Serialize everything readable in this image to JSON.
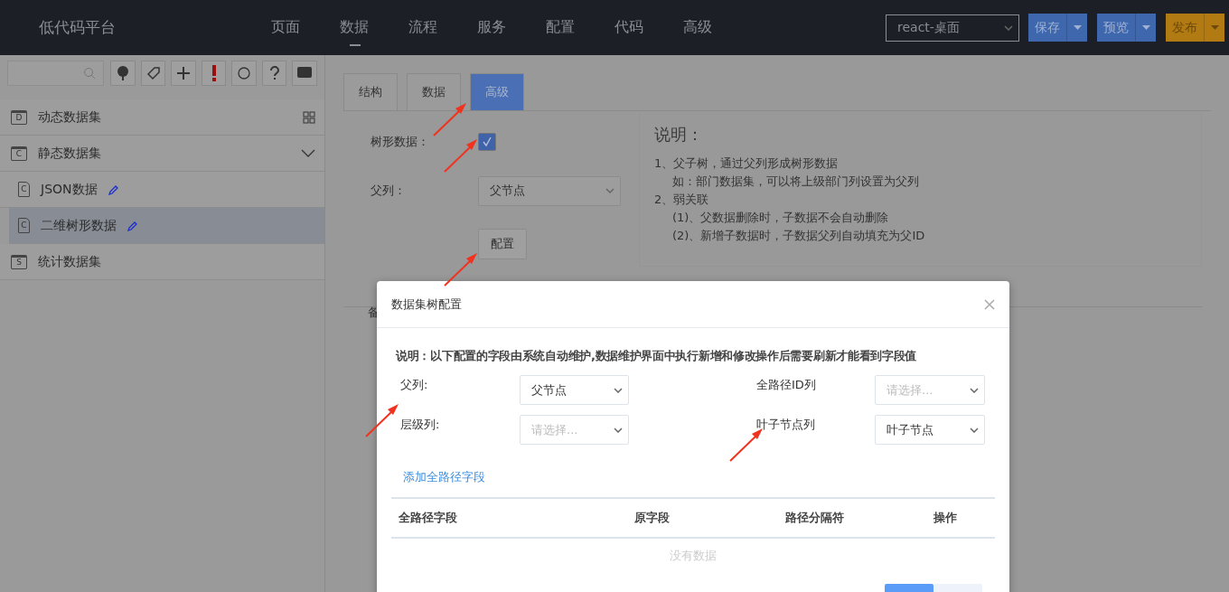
{
  "app": {
    "title": "低代码平台"
  },
  "nav": [
    {
      "label": "页面",
      "selected": false
    },
    {
      "label": "数据",
      "selected": true
    },
    {
      "label": "流程",
      "selected": false
    },
    {
      "label": "服务",
      "selected": false
    },
    {
      "label": "配置",
      "selected": false
    },
    {
      "label": "代码",
      "selected": false
    },
    {
      "label": "高级",
      "selected": false
    }
  ],
  "platform_select": {
    "value": "react-桌面"
  },
  "actions": [
    {
      "label": "保存",
      "kind": "primary"
    },
    {
      "label": "预览",
      "kind": "primary"
    },
    {
      "label": "发布",
      "kind": "warning"
    }
  ],
  "sidebar": {
    "toolbar": [
      {
        "kind": "tree"
      },
      {
        "kind": "tag"
      },
      {
        "kind": "plus"
      },
      {
        "kind": "alert"
      },
      {
        "kind": "refresh"
      },
      {
        "kind": "help"
      },
      {
        "kind": "chat"
      }
    ],
    "items": [
      {
        "label": "动态数据集",
        "letter": "D",
        "kind": "group",
        "expanded": false,
        "selected": false
      },
      {
        "label": "静态数据集",
        "letter": "C",
        "kind": "group",
        "expanded": true,
        "selected": false,
        "children": [
          {
            "label": "JSON数据",
            "letter": "C",
            "kind": "item",
            "selected": false
          },
          {
            "label": "二维树形数据",
            "letter": "C",
            "kind": "item",
            "selected": true
          }
        ]
      },
      {
        "label": "统计数据集",
        "letter": "S",
        "kind": "group",
        "expanded": false,
        "selected": false
      }
    ]
  },
  "tabs": [
    {
      "label": "结构",
      "selected": false
    },
    {
      "label": "数据",
      "selected": false
    },
    {
      "label": "高级",
      "selected": true
    }
  ],
  "form": {
    "tree_label": "树形数据：",
    "tree_checked": true,
    "parent_label": "父列：",
    "parent_value": "父节点",
    "config_button": "配置"
  },
  "help": {
    "title": "说明：",
    "lines": [
      "1、父子树，通过父列形成树形数据",
      "如：部门数据集，可以将上级部门列设置为父列",
      "2、弱关联",
      "(1)、父数据删除时，子数据不会自动删除",
      "(2)、新增子数据时，子数据父列自动填充为父ID"
    ]
  },
  "hidden_label": "备",
  "dialog": {
    "title": "数据集树配置",
    "note": "说明：以下配置的字段由系统自动维护,数据维护界面中执行新增和修改操作后需要刷新才能看到字段值",
    "fields": [
      {
        "label": "父列:",
        "value": "父节点"
      },
      {
        "label": "全路径ID列",
        "placeholder": "请选择..."
      },
      {
        "label": "层级列:",
        "placeholder": "请选择..."
      },
      {
        "label": "叶子节点列",
        "value": "叶子节点"
      }
    ],
    "link": "添加全路径字段",
    "columns": [
      "全路径字段",
      "原字段",
      "路径分隔符",
      "操作"
    ],
    "empty": "没有数据"
  }
}
